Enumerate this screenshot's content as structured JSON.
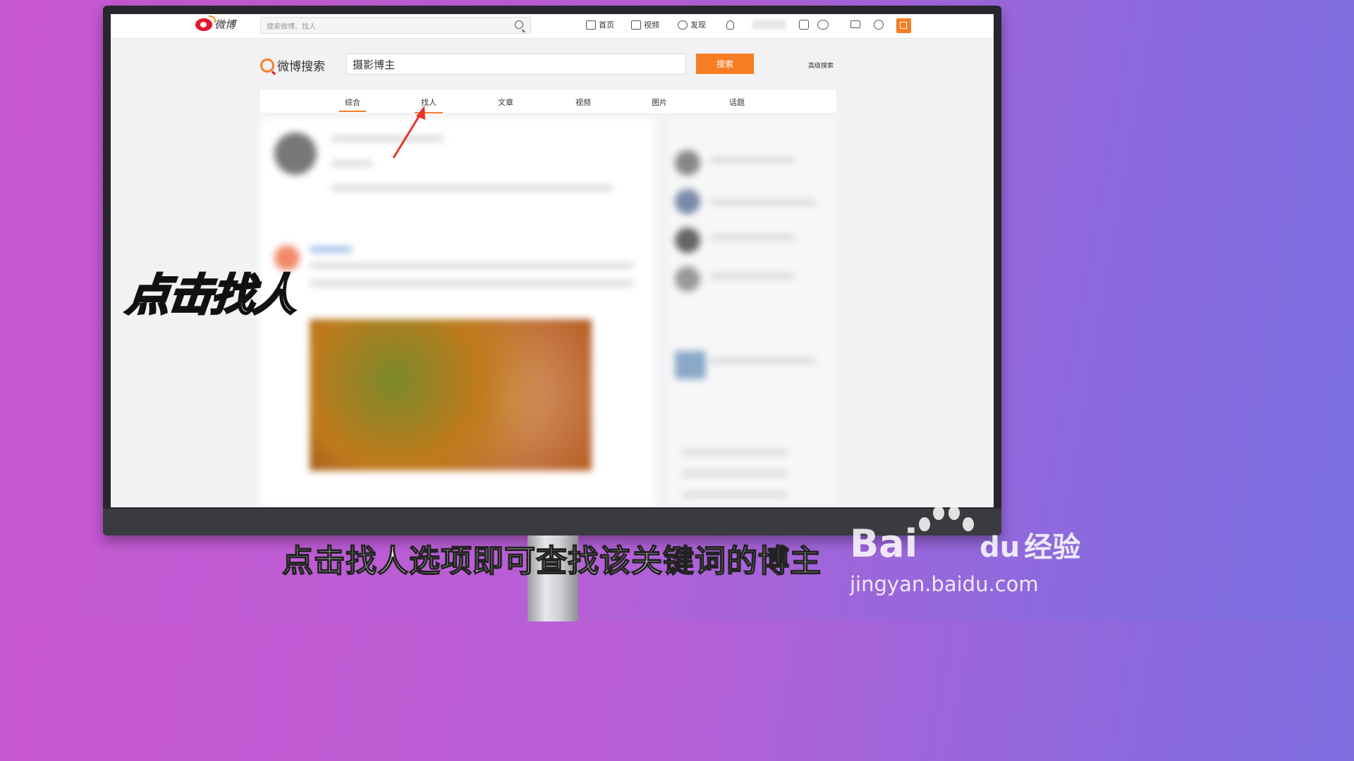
{
  "weibo": {
    "logo_text": "微博",
    "top_search_placeholder": "搜索微博、找人",
    "nav": {
      "home": "首页",
      "video": "视频",
      "discover": "发现"
    }
  },
  "search": {
    "logo_text": "微博搜索",
    "query": "摄影博主",
    "button": "搜索",
    "advanced": "高级搜索"
  },
  "tabs": [
    {
      "label": "综合",
      "active": true
    },
    {
      "label": "找人",
      "active": false
    },
    {
      "label": "文章",
      "active": false
    },
    {
      "label": "视频",
      "active": false
    },
    {
      "label": "图片",
      "active": false
    },
    {
      "label": "话题",
      "active": false
    }
  ],
  "overlay": {
    "caption": "点击找人",
    "subtitle": "点击找人选项即可查找该关键词的博主"
  },
  "watermark": {
    "brand": "Bai",
    "brand_cn": "经验",
    "url": "jingyan.baidu.com"
  },
  "colors": {
    "accent": "#f57e24",
    "weibo_red": "#e6162d",
    "arrow": "#e8332a"
  }
}
